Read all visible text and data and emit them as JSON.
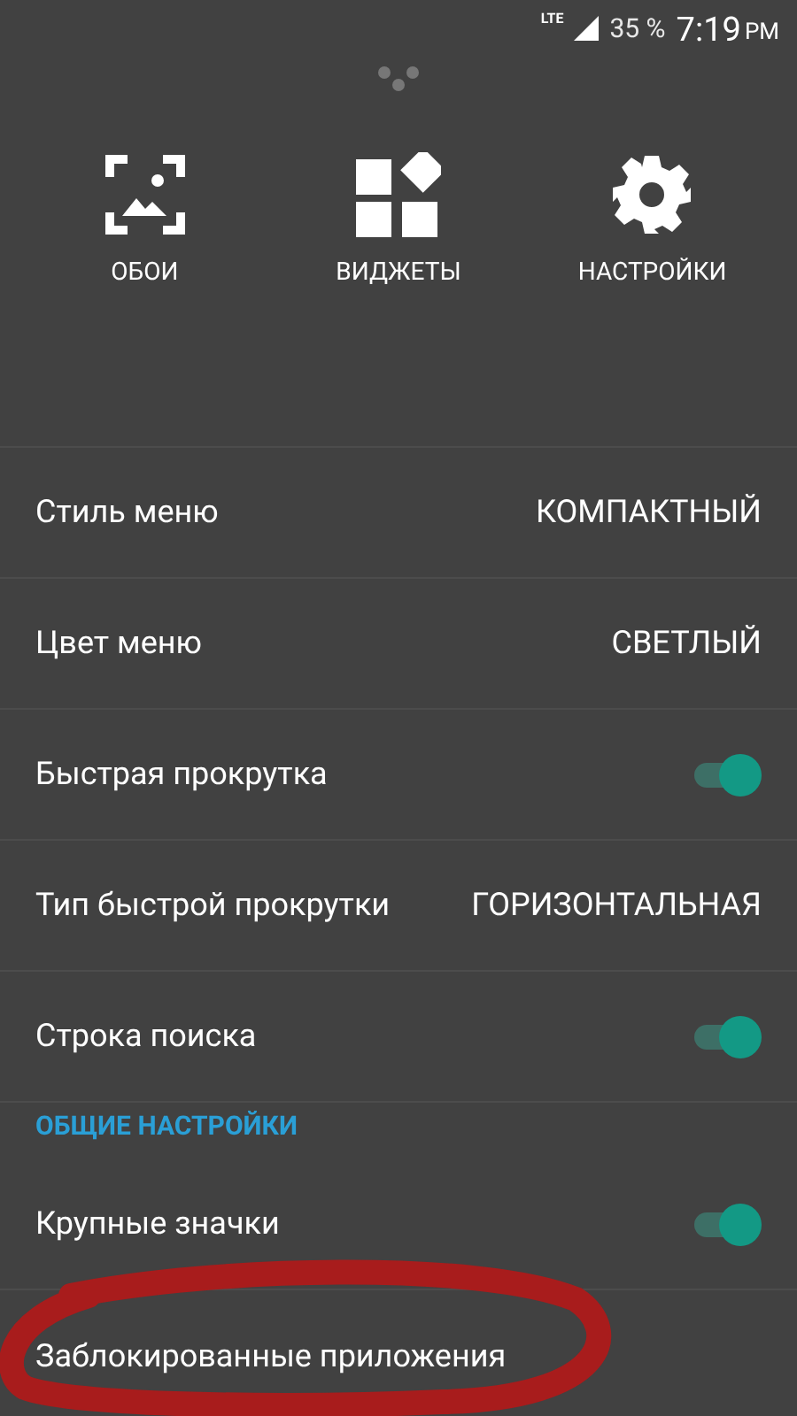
{
  "status_bar": {
    "network": "LTE",
    "battery": "35 %",
    "time": "7:19",
    "ampm": "PM"
  },
  "shortcuts": [
    {
      "kind": "wallpaper",
      "label": "ОБОИ"
    },
    {
      "kind": "widgets",
      "label": "ВИДЖЕТЫ"
    },
    {
      "kind": "settings",
      "label": "НАСТРОЙКИ"
    }
  ],
  "settings": [
    {
      "kind": "value",
      "label": "Стиль меню",
      "value": "КОМПАКТНЫЙ"
    },
    {
      "kind": "value",
      "label": "Цвет меню",
      "value": "СВЕТЛЫЙ"
    },
    {
      "kind": "toggle",
      "label": "Быстрая прокрутка",
      "on": true
    },
    {
      "kind": "value",
      "label": "Тип быстрой прокрутки",
      "value": "ГОРИЗОНТАЛЬНАЯ"
    },
    {
      "kind": "toggle",
      "label": "Строка поиска",
      "on": true
    },
    {
      "kind": "header",
      "label": "ОБЩИЕ НАСТРОЙКИ"
    },
    {
      "kind": "toggle",
      "label": "Крупные значки",
      "on": true
    },
    {
      "kind": "plain",
      "label": "Заблокированные приложения"
    }
  ],
  "annotation": {
    "kind": "circle",
    "color": "#a81c1c"
  }
}
